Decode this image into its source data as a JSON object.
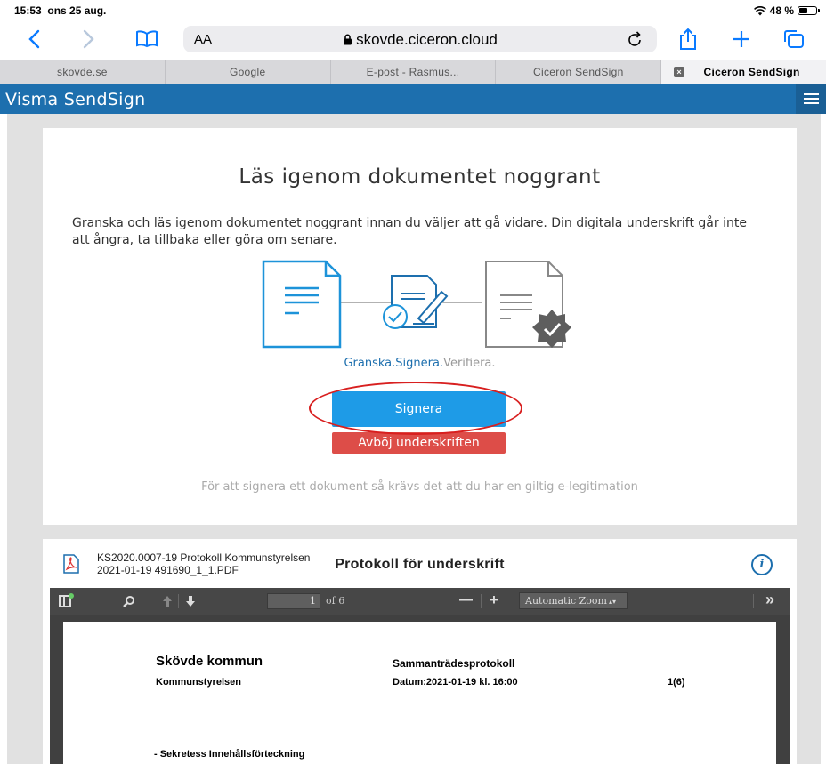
{
  "status": {
    "time": "15:53",
    "date": "ons 25 aug.",
    "battery": "48 %",
    "battery_level": 0.48
  },
  "browser": {
    "aa_label": "AA",
    "url": "skovde.ciceron.cloud"
  },
  "tabs": [
    {
      "label": "skovde.se",
      "active": false
    },
    {
      "label": "Google",
      "active": false
    },
    {
      "label": "E-post - Rasmus...",
      "active": false
    },
    {
      "label": "Ciceron SendSign",
      "active": false
    },
    {
      "label": "Ciceron SendSign",
      "active": true
    }
  ],
  "app": {
    "brand": "Visma SendSign"
  },
  "card": {
    "title": "Läs igenom dokumentet noggrant",
    "intro": "Granska och läs igenom dokumentet noggrant innan du väljer att gå vidare. Din digitala underskrift går inte att ångra, ta tillbaka eller göra om senare.",
    "tagline_a": "Granska.",
    "tagline_b": "Signera.",
    "tagline_c": "Verifiera.",
    "sign_label": "Signera",
    "reject_label": "Avböj underskriften",
    "note": "För att signera ett dokument så krävs det att du har en giltig e-legitimation"
  },
  "document": {
    "filename": "KS2020.0007-19 Protokoll Kommunstyrelsen 2021-01-19 491690_1_1.PDF",
    "title": "Protokoll för underskrift",
    "info_symbol": "i"
  },
  "pdf": {
    "page_number": "1",
    "of_pages": "of 6",
    "zoom": "Automatic Zoom",
    "minus": "—",
    "plus": "+",
    "more": "»",
    "content": {
      "org": "Skövde kommun",
      "dept": "Kommunstyrelsen",
      "doc_type": "Sammanträdesprotokoll",
      "date": "Datum:2021-01-19 kl. 16:00",
      "pages": "1(6)",
      "section": "- Sekretess Innehållsförteckning"
    }
  },
  "colors": {
    "brand": "#1d6fae",
    "sign": "#1e9be7",
    "reject": "#dd4d48",
    "annotation": "#d81f1f"
  }
}
